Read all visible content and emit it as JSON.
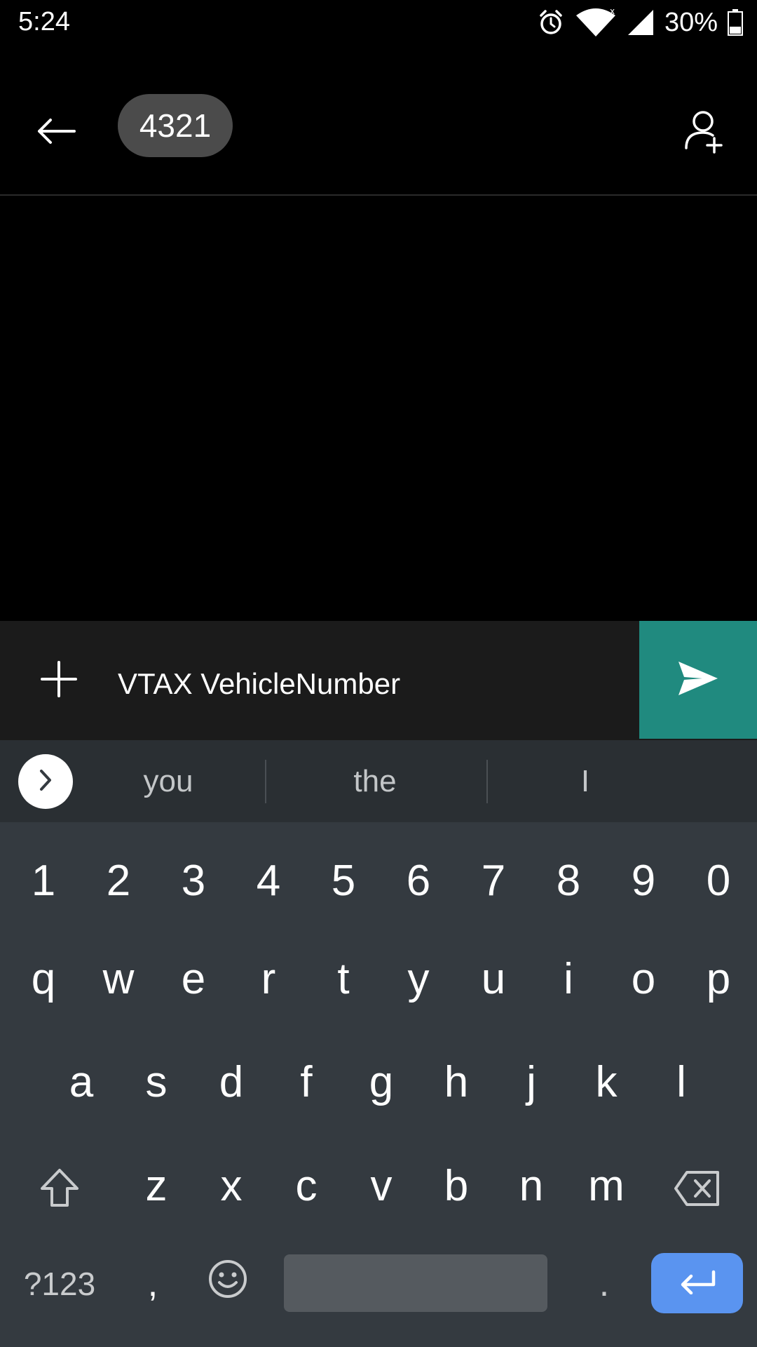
{
  "status_bar": {
    "time": "5:24",
    "battery_percent": "30%",
    "icons": [
      "alarm-icon",
      "wifi-icon",
      "cell-signal-icon",
      "battery-icon"
    ]
  },
  "header": {
    "back_icon": "arrow-left-icon",
    "contact_chip": "4321",
    "add_contact_icon": "add-person-icon"
  },
  "compose": {
    "attach_icon": "plus-icon",
    "value": "VTAX VehicleNumber",
    "send_icon": "send-icon",
    "send_color": "#208a7f"
  },
  "keyboard": {
    "suggestions": [
      "you",
      "the",
      "I"
    ],
    "row_numbers": [
      "1",
      "2",
      "3",
      "4",
      "5",
      "6",
      "7",
      "8",
      "9",
      "0"
    ],
    "row_1": [
      "q",
      "w",
      "e",
      "r",
      "t",
      "y",
      "u",
      "i",
      "o",
      "p"
    ],
    "row_2": [
      "a",
      "s",
      "d",
      "f",
      "g",
      "h",
      "j",
      "k",
      "l"
    ],
    "row_3": [
      "z",
      "x",
      "c",
      "v",
      "b",
      "n",
      "m"
    ],
    "symbols_label": "?123",
    "comma": ",",
    "period": ".",
    "enter_color": "#5a94f0"
  }
}
